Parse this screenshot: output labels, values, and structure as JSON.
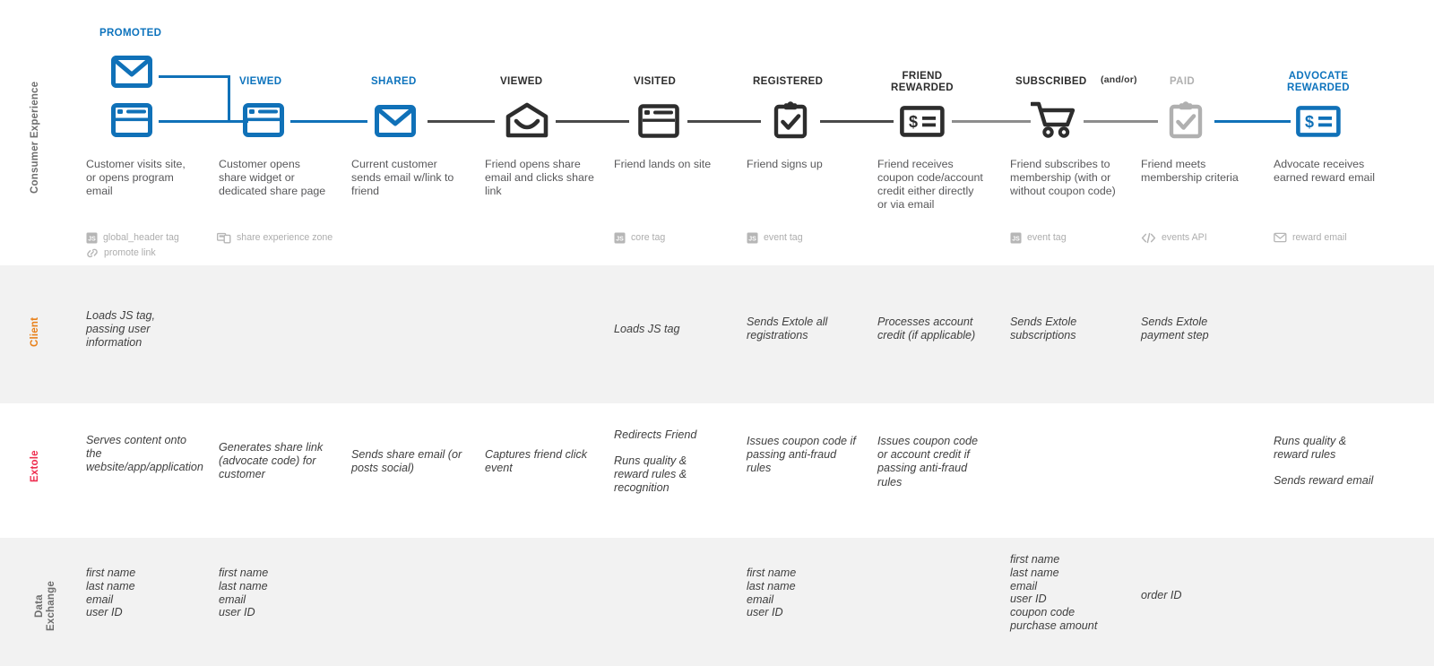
{
  "rows": {
    "consumer": {
      "label": "Consumer Experience",
      "color": "#6e6e6e"
    },
    "client": {
      "label": "Client",
      "color": "#e8801a"
    },
    "extole": {
      "label": "Extole",
      "color": "#ee2d4f"
    },
    "data": {
      "label": "Data\nExchange",
      "color": "#6e6e6e"
    }
  },
  "annotations": {
    "and_or": "(and/or)"
  },
  "stages": [
    {
      "key": "promoted",
      "name": "PROMOTED",
      "name_style": "blue",
      "icons": [
        "envelope-icon",
        "browser-window-icon"
      ],
      "description": "Customer visits site, or opens program email",
      "tags": [
        {
          "icon": "js-tag-icon",
          "label": "global_header tag"
        },
        {
          "icon": "link-icon",
          "label": "promote link"
        }
      ],
      "client": "Loads JS tag, passing user information",
      "extole": [
        "Serves content onto the website/app/application"
      ],
      "data": "first name\nlast name\nemail\nuser ID"
    },
    {
      "key": "viewed-1",
      "name": "VIEWED",
      "name_style": "blue",
      "icons": [
        "browser-window-icon"
      ],
      "description": "Customer opens share widget or dedicated share page",
      "tags": [
        {
          "icon": "share-zone-icon",
          "label": "share experience zone"
        }
      ],
      "client": "",
      "extole": [
        "Generates share link (advocate code) for customer"
      ],
      "data": "first name\nlast name\nemail\nuser ID"
    },
    {
      "key": "shared",
      "name": "SHARED",
      "name_style": "blue",
      "icons": [
        "envelope-icon"
      ],
      "description": "Current customer sends email w/link to friend",
      "tags": [],
      "client": "",
      "extole": [
        "Sends share email (or posts social)"
      ],
      "data": ""
    },
    {
      "key": "viewed-2",
      "name": "VIEWED",
      "name_style": "dark",
      "icons": [
        "open-envelope-icon"
      ],
      "description": "Friend opens share email and clicks share link",
      "tags": [],
      "client": "",
      "extole": [
        "Captures friend click event"
      ],
      "data": ""
    },
    {
      "key": "visited",
      "name": "VISITED",
      "name_style": "dark",
      "icons": [
        "browser-window-icon"
      ],
      "description": "Friend lands on site",
      "tags": [
        {
          "icon": "js-tag-icon",
          "label": "core tag"
        }
      ],
      "client": "Loads JS tag",
      "extole": [
        "Redirects Friend",
        "Runs quality & reward rules & recognition"
      ],
      "data": ""
    },
    {
      "key": "registered",
      "name": "REGISTERED",
      "name_style": "dark",
      "icons": [
        "clipboard-check-icon"
      ],
      "description": "Friend signs up",
      "tags": [
        {
          "icon": "js-tag-icon",
          "label": "event tag"
        }
      ],
      "client": "Sends Extole all registrations",
      "extole": [
        "Issues coupon code if passing anti-fraud rules"
      ],
      "data": "first name\nlast name\nemail\nuser ID"
    },
    {
      "key": "friend-rewarded",
      "name": "FRIEND\nREWARDED",
      "name_style": "dark",
      "icons": [
        "coupon-icon"
      ],
      "description": "Friend receives coupon code/account credit either directly or via email",
      "tags": [],
      "client": "Processes account credit (if applicable)",
      "extole": [
        "Issues coupon code or account credit if passing anti-fraud rules"
      ],
      "data": ""
    },
    {
      "key": "subscribed",
      "name": "SUBSCRIBED",
      "name_style": "dark",
      "icons": [
        "shopping-cart-icon"
      ],
      "description": "Friend subscribes to membership (with or without coupon code)",
      "tags": [
        {
          "icon": "js-tag-icon",
          "label": "event tag"
        }
      ],
      "client": "Sends Extole subscriptions",
      "extole": [],
      "data": "first name\nlast name\nemail\nuser ID\ncoupon code\npurchase amount"
    },
    {
      "key": "paid",
      "name": "PAID",
      "name_style": "gray",
      "icons": [
        "clipboard-check-gray-icon"
      ],
      "description": "Friend meets membership criteria",
      "tags": [
        {
          "icon": "code-api-icon",
          "label": "events API"
        }
      ],
      "client": "Sends Extole payment step",
      "extole": [],
      "data": "order ID"
    },
    {
      "key": "advocate-rewarded",
      "name": "ADVOCATE\nREWARDED",
      "name_style": "blue",
      "icons": [
        "coupon-blue-icon"
      ],
      "description": "Advocate receives earned reward email",
      "tags": [
        {
          "icon": "mail-icon",
          "label": "reward email"
        }
      ],
      "client": "",
      "extole": [
        "Runs quality & reward rules",
        "Sends reward email"
      ],
      "data": ""
    }
  ],
  "colors": {
    "brand_blue": "#0d73bd",
    "line_blue": "#1071b8",
    "line_dark": "#4a4a4a",
    "line_gray": "#8d8d8d",
    "icon_dark": "#2d2d2d",
    "icon_gray": "#b0b0b0",
    "band_bg": "#f2f2f2",
    "client_orange": "#e8801a",
    "extole_red": "#ee2d4f"
  }
}
